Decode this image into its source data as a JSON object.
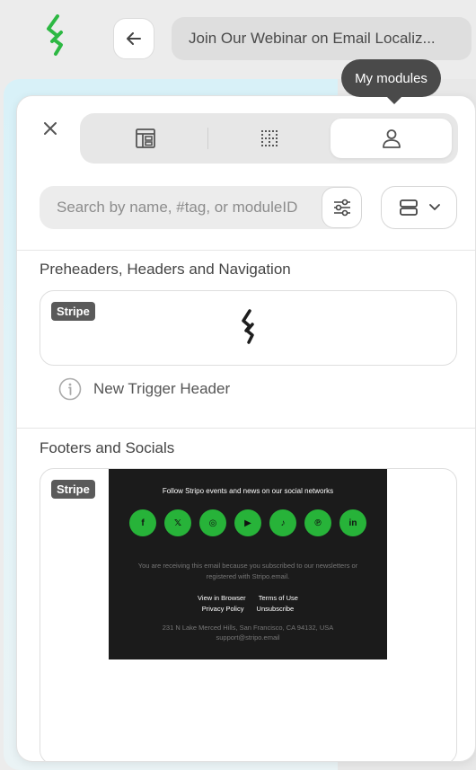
{
  "topbar": {
    "logo_icon": "stripo-logo-icon",
    "back_icon": "arrow-left-icon",
    "title": "Join Our Webinar on Email Localiz..."
  },
  "tooltip": {
    "text": "My modules"
  },
  "tabs": [
    {
      "icon": "layout-modules-icon"
    },
    {
      "icon": "grid-dotted-icon"
    },
    {
      "icon": "user-icon",
      "selected": true
    }
  ],
  "search": {
    "placeholder": "Search by name, #tag, or moduleID",
    "value": ""
  },
  "sections": [
    {
      "title": "Preheaders, Headers and Navigation",
      "modules": [
        {
          "badge": "Stripe",
          "name": "New Trigger Header",
          "info_icon": "info-icon"
        }
      ]
    },
    {
      "title": "Footers and Socials",
      "modules": [
        {
          "badge": "Stripe",
          "preview": {
            "heading": "Follow Stripo events and news on our social networks",
            "socials": [
              "f",
              "𝕏",
              "◎",
              "▶",
              "♪",
              "℗",
              "in"
            ],
            "notice": "You are receiving this email because you subscribed to our newsletters or registered with Stripo.email.",
            "links": [
              "View in Browser",
              "Terms of Use",
              "Privacy Policy",
              "Unsubscribe"
            ],
            "address": "231 N Lake Merced Hills, San Francisco, CA 94132, USA",
            "email": "support@stripo.email"
          }
        }
      ]
    }
  ],
  "colors": {
    "accent": "#27b339",
    "tooltip_bg": "#4a4a4a",
    "badge_bg": "#5a5a5a"
  }
}
